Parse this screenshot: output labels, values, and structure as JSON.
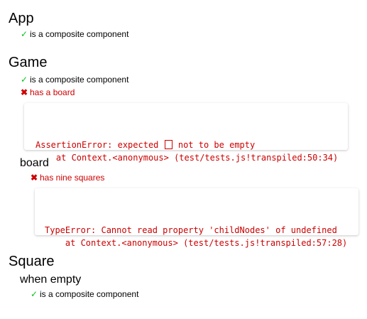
{
  "suites": {
    "app": {
      "title": "App",
      "tests": [
        {
          "status": "pass",
          "mark": "✓",
          "label": "is a composite component"
        }
      ]
    },
    "game": {
      "title": "Game",
      "tests": [
        {
          "status": "pass",
          "mark": "✓",
          "label": "is a composite component"
        },
        {
          "status": "fail",
          "mark": "✖",
          "label": "has a board"
        }
      ],
      "error": {
        "message_before": "AssertionError: expected ",
        "message_after": " not to be empty",
        "stack": "    at Context.<anonymous> (test/tests.js!transpiled:50:34)"
      },
      "board": {
        "title": "board",
        "tests": [
          {
            "status": "fail",
            "mark": "✖",
            "label": "has nine squares"
          }
        ],
        "error": {
          "message": "TypeError: Cannot read property 'childNodes' of undefined",
          "stack": "    at Context.<anonymous> (test/tests.js!transpiled:57:28)"
        }
      }
    },
    "square": {
      "title": "Square",
      "when_empty": {
        "title": "when empty",
        "tests": [
          {
            "status": "pass",
            "mark": "✓",
            "label": "is a composite component"
          }
        ]
      }
    }
  },
  "colors": {
    "pass": "#00c41c",
    "fail": "#cc0000"
  }
}
